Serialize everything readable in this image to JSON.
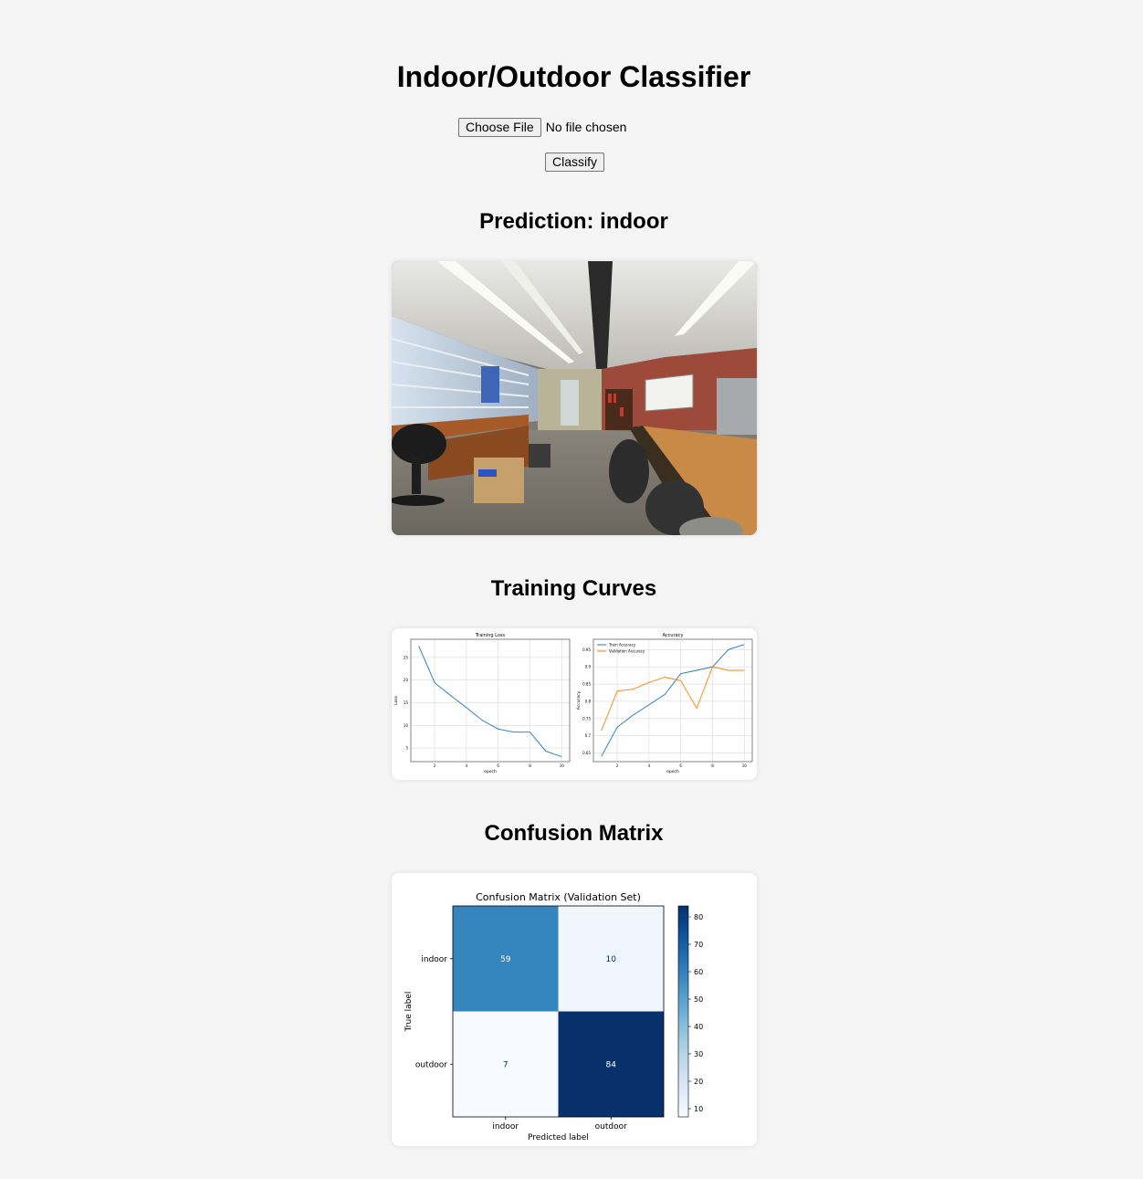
{
  "header": {
    "title": "Indoor/Outdoor Classifier"
  },
  "upload": {
    "choose_file_label": "Choose File",
    "file_status": "No file chosen",
    "classify_label": "Classify"
  },
  "prediction": {
    "label": "Prediction: indoor"
  },
  "sections": {
    "training_curves": "Training Curves",
    "confusion_matrix": "Confusion Matrix"
  },
  "chart_data": [
    {
      "type": "line",
      "title": "Training Loss",
      "xlabel": "epoch",
      "ylabel": "Loss",
      "x": [
        1,
        2,
        3,
        4,
        5,
        6,
        7,
        8,
        9,
        10
      ],
      "series": [
        {
          "values": [
            27.5,
            19.4,
            16.6,
            13.9,
            11.1,
            9.2,
            8.5,
            8.5,
            4.3,
            3.1
          ]
        }
      ],
      "xticks": [
        2,
        4,
        6,
        8,
        10
      ],
      "yticks": [
        5,
        10,
        15,
        20,
        25
      ],
      "xlim": [
        0.5,
        10.5
      ],
      "ylim": [
        2,
        29
      ],
      "grid": true,
      "color": "#1f77b4"
    },
    {
      "type": "line",
      "title": "Accuracy",
      "xlabel": "epoch",
      "ylabel": "Accuracy",
      "x": [
        1,
        2,
        3,
        4,
        5,
        6,
        7,
        8,
        9,
        10
      ],
      "series": [
        {
          "name": "Train Accuracy",
          "values": [
            0.64,
            0.725,
            0.76,
            0.79,
            0.82,
            0.88,
            0.89,
            0.9,
            0.95,
            0.965
          ]
        },
        {
          "name": "Validation Accuracy",
          "values": [
            0.715,
            0.83,
            0.835,
            0.855,
            0.87,
            0.86,
            0.78,
            0.9,
            0.89,
            0.89
          ]
        }
      ],
      "xticks": [
        2,
        4,
        6,
        8,
        10
      ],
      "yticks": [
        0.65,
        0.7,
        0.75,
        0.8,
        0.85,
        0.9,
        0.95
      ],
      "xlim": [
        0.5,
        10.5
      ],
      "ylim": [
        0.625,
        0.98
      ],
      "legend": "top-left",
      "grid": true,
      "colors": [
        "#1f77b4",
        "#ff7f0e"
      ]
    },
    {
      "type": "heatmap",
      "title": "Confusion Matrix (Validation Set)",
      "xlabel": "Predicted label",
      "ylabel": "True label",
      "rows": [
        "indoor",
        "outdoor"
      ],
      "cols": [
        "indoor",
        "outdoor"
      ],
      "values": [
        [
          59,
          10
        ],
        [
          7,
          84
        ]
      ],
      "colorbar_ticks": [
        10,
        20,
        30,
        40,
        50,
        60,
        70,
        80
      ],
      "colormap": "Blues",
      "vmin": 7,
      "vmax": 84
    }
  ],
  "colors": {
    "page_background": "#f5f5f5",
    "card_background": "#ffffff"
  },
  "photo": {
    "subject": "indoor-office-photo"
  }
}
